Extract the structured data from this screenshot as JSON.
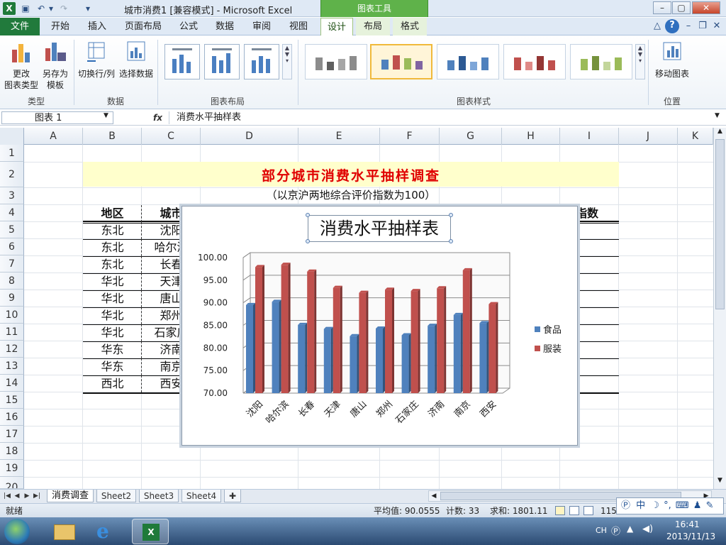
{
  "window": {
    "title": "城市消费1  [兼容模式] - Microsoft Excel",
    "context_tab": "图表工具",
    "app_icon": "X"
  },
  "ribbon_tabs": [
    "文件",
    "开始",
    "插入",
    "页面布局",
    "公式",
    "数据",
    "审阅",
    "视图",
    "设计",
    "布局",
    "格式"
  ],
  "ribbon": {
    "type_group": {
      "change_type": "更改\n图表类型",
      "save_template": "另存为\n模板",
      "label": "类型"
    },
    "data_group": {
      "switch_row_col": "切换行/列",
      "select_data": "选择数据",
      "label": "数据"
    },
    "layout_group": {
      "label": "图表布局"
    },
    "styles_group": {
      "label": "图表样式"
    },
    "location_group": {
      "move_chart": "移动图表",
      "label": "位置"
    }
  },
  "formula_bar": {
    "name_box": "图表 1",
    "fx": "fx",
    "formula": "消费水平抽样表"
  },
  "columns": [
    "A",
    "B",
    "C",
    "D",
    "E",
    "F",
    "G",
    "H",
    "I",
    "J",
    "K"
  ],
  "rows": [
    "1",
    "2",
    "3",
    "4",
    "5",
    "6",
    "7",
    "8",
    "9",
    "10",
    "11",
    "12",
    "13",
    "14",
    "15",
    "16",
    "17",
    "18",
    "19",
    "20"
  ],
  "sheet": {
    "title": "部分城市消费水平抽样调查",
    "subtitle": "（以京沪两地综合评价指数为100）",
    "headers": {
      "region": "地区",
      "city": "城市",
      "index": "总指数"
    },
    "regions": [
      "东北",
      "东北",
      "东北",
      "华北",
      "华北",
      "华北",
      "华北",
      "华东",
      "华东",
      "西北"
    ],
    "cities_visible": [
      "沈阳",
      "哈尔滨",
      "长春",
      "天津",
      "唐山",
      "郑州",
      "石家庄",
      "济南",
      "南京",
      "西安"
    ]
  },
  "chart_data": {
    "type": "bar",
    "title": "消费水平抽样表",
    "categories": [
      "沈阳",
      "哈尔滨",
      "长春",
      "天津",
      "唐山",
      "郑州",
      "石家庄",
      "济南",
      "南京",
      "西安"
    ],
    "series": [
      {
        "name": "食品",
        "values": [
          89.5,
          90.2,
          85.1,
          84.2,
          82.6,
          84.3,
          82.8,
          84.9,
          87.3,
          85.5
        ],
        "color": "#4f81bd"
      },
      {
        "name": "服装",
        "values": [
          97.9,
          98.4,
          96.9,
          93.3,
          92.2,
          92.9,
          92.6,
          93.2,
          97.2,
          89.7
        ],
        "color": "#c0504d"
      }
    ],
    "ylim": [
      70,
      100
    ],
    "yticks": [
      "70.00",
      "75.00",
      "80.00",
      "85.00",
      "90.00",
      "95.00",
      "100.00"
    ],
    "legend": "right",
    "grid": true
  },
  "sheet_tabs": [
    "消费调查",
    "Sheet2",
    "Sheet3",
    "Sheet4"
  ],
  "status": {
    "mode": "就绪",
    "average": "平均值: 90.0555",
    "count": "计数: 33",
    "sum": "求和: 1801.11",
    "zoom": "115"
  },
  "ime": {
    "label": "中"
  },
  "tray": {
    "lang": "CH",
    "time": "16:41",
    "date": "2013/11/13"
  }
}
